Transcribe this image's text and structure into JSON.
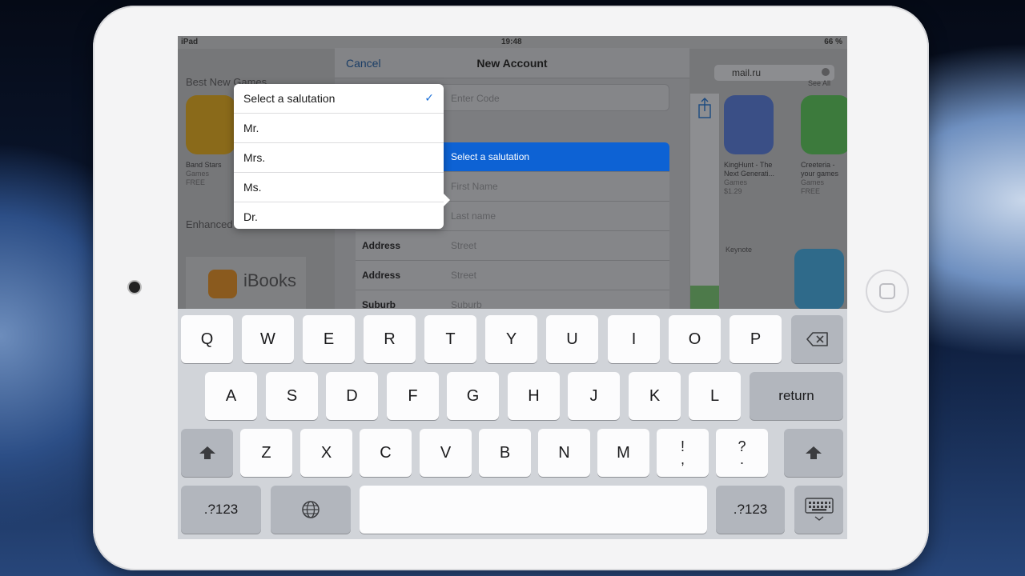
{
  "status": {
    "left": "iPad",
    "time": "19:48",
    "right": "66 %"
  },
  "background": {
    "search_text": "mail.ru",
    "heading_games": "Best New Games",
    "heading_enhanced": "Enhanced",
    "see_all": "See All",
    "apps": [
      {
        "name": "Band Stars",
        "category": "Games",
        "price": "FREE",
        "color": "#8a6a1a"
      },
      {
        "name": "KingHunt - The Next Generati...",
        "category": "Games",
        "price": "$1.29",
        "color": "#3a4f86"
      },
      {
        "name": "Creeteria - your games",
        "category": "Games",
        "price": "FREE",
        "color": "#3c7a3c"
      }
    ],
    "ibooks_label": "iBooks",
    "keynote_label": "Keynote"
  },
  "modal": {
    "cancel": "Cancel",
    "title": "New Account",
    "code_placeholder": "Enter Code",
    "rows": [
      {
        "label": "",
        "placeholder": "Select a salutation",
        "selected": true
      },
      {
        "label": "",
        "placeholder": "First Name"
      },
      {
        "label": "",
        "placeholder": "Last name"
      },
      {
        "label": "Address",
        "placeholder": "Street"
      },
      {
        "label": "Address",
        "placeholder": "Street"
      },
      {
        "label": "Suburb",
        "placeholder": "Suburb"
      }
    ]
  },
  "popover": {
    "options": [
      {
        "label": "Select a salutation",
        "checked": true
      },
      {
        "label": "Mr."
      },
      {
        "label": "Mrs."
      },
      {
        "label": "Ms."
      },
      {
        "label": "Dr."
      }
    ]
  },
  "keyboard": {
    "row1": [
      "Q",
      "W",
      "E",
      "R",
      "T",
      "Y",
      "U",
      "I",
      "O",
      "P"
    ],
    "row2": [
      "A",
      "S",
      "D",
      "F",
      "G",
      "H",
      "J",
      "K",
      "L"
    ],
    "row3": [
      "Z",
      "X",
      "C",
      "V",
      "B",
      "N",
      "M"
    ],
    "return": "return",
    "numbers": ".?123",
    "exclaim": [
      "!",
      ","
    ],
    "question": [
      "?",
      "."
    ]
  },
  "icons": {
    "backspace": "backspace-icon",
    "shift": "shift-icon",
    "globe": "globe-icon",
    "hide_keyboard": "keyboard-hide-icon",
    "share": "share-icon",
    "check": "checkmark-icon"
  }
}
